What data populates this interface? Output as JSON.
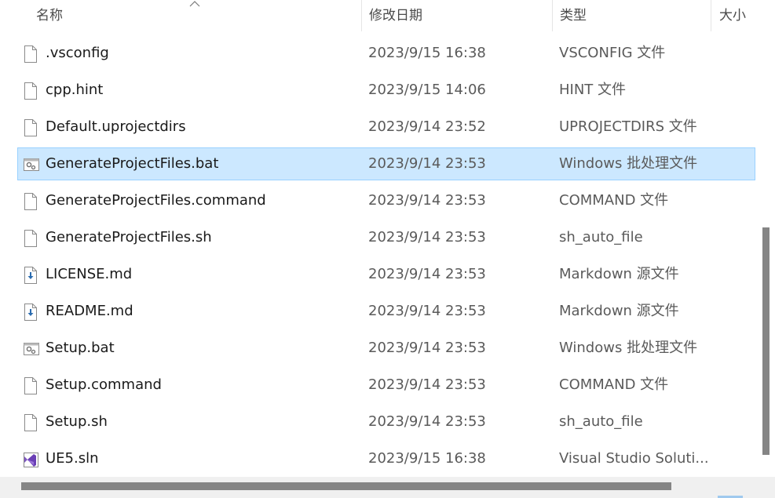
{
  "header": {
    "name": "名称",
    "date_modified": "修改日期",
    "type": "类型",
    "size": "大小"
  },
  "files": [
    {
      "name": ".vsconfig",
      "date": "2023/9/15 16:38",
      "type": "VSCONFIG 文件",
      "icon": "blank-file-icon",
      "selected": false
    },
    {
      "name": "cpp.hint",
      "date": "2023/9/15 14:06",
      "type": "HINT 文件",
      "icon": "blank-file-icon",
      "selected": false
    },
    {
      "name": "Default.uprojectdirs",
      "date": "2023/9/14 23:52",
      "type": "UPROJECTDIRS 文件",
      "icon": "blank-file-icon",
      "selected": false
    },
    {
      "name": "GenerateProjectFiles.bat",
      "date": "2023/9/14 23:53",
      "type": "Windows 批处理文件",
      "icon": "batch-file-icon",
      "selected": true
    },
    {
      "name": "GenerateProjectFiles.command",
      "date": "2023/9/14 23:53",
      "type": "COMMAND 文件",
      "icon": "blank-file-icon",
      "selected": false
    },
    {
      "name": "GenerateProjectFiles.sh",
      "date": "2023/9/14 23:53",
      "type": "sh_auto_file",
      "icon": "blank-file-icon",
      "selected": false
    },
    {
      "name": "LICENSE.md",
      "date": "2023/9/14 23:53",
      "type": "Markdown 源文件",
      "icon": "markdown-file-icon",
      "selected": false
    },
    {
      "name": "README.md",
      "date": "2023/9/14 23:53",
      "type": "Markdown 源文件",
      "icon": "markdown-file-icon",
      "selected": false
    },
    {
      "name": "Setup.bat",
      "date": "2023/9/14 23:53",
      "type": "Windows 批处理文件",
      "icon": "batch-file-icon",
      "selected": false
    },
    {
      "name": "Setup.command",
      "date": "2023/9/14 23:53",
      "type": "COMMAND 文件",
      "icon": "blank-file-icon",
      "selected": false
    },
    {
      "name": "Setup.sh",
      "date": "2023/9/14 23:53",
      "type": "sh_auto_file",
      "icon": "blank-file-icon",
      "selected": false
    },
    {
      "name": "UE5.sln",
      "date": "2023/9/15 16:38",
      "type": "Visual Studio Soluti...",
      "icon": "visual-studio-solution-icon",
      "selected": false
    }
  ],
  "colors": {
    "selection_bg": "#cce8ff",
    "selection_border": "#99d1ff",
    "scroll_thumb": "#858585"
  }
}
